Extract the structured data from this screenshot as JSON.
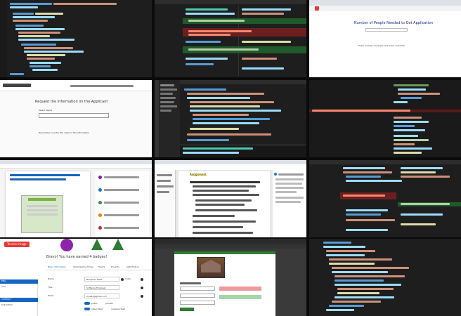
{
  "grid": {
    "tiles": [
      {
        "name": "vscode-code-editor-1"
      },
      {
        "name": "vscode-diff-view"
      },
      {
        "name": "browser-number-of-people-page"
      },
      {
        "name": "browser-form-page"
      },
      {
        "name": "vscode-explorer-editor"
      },
      {
        "name": "terminal-dark-editor"
      },
      {
        "name": "browser-document-editor"
      },
      {
        "name": "word-document-assignment"
      },
      {
        "name": "vscode-diff-red-lines"
      },
      {
        "name": "profile-badges-page"
      },
      {
        "name": "browser-landscape-form"
      },
      {
        "name": "vscode-code-editor-2"
      }
    ]
  },
  "tile3": {
    "title": "Number of People Needed to Get Application",
    "note": "Enter number of people and press calculate"
  },
  "tile4": {
    "title": "Request the Information on the Applicant",
    "field_label": "Select Name",
    "footer": "Remember to enter the data for the information"
  },
  "tile10": {
    "button": "Tennes Image",
    "heading": "Bravo! You have earned 4 badges!",
    "tabs": [
      "Basic Information",
      "Volunteering Times",
      "Teams",
      "Projects",
      "Skill History"
    ],
    "field_labels": [
      "Name",
      "Title",
      "Email"
    ],
    "field_values": [
      "Benjamin Baltz",
      "Software Engineer",
      "b.baltz@gmail.com"
    ],
    "side_values": [
      "Cuba",
      "",
      ""
    ],
    "sidebar": [
      "ENG",
      "mail",
      "",
      "CONTACT",
      "Submitted"
    ],
    "toggles": [
      "public",
      "private",
      "subscribed",
      "unsubscribed"
    ]
  },
  "tile8": {
    "heading": "Assignment",
    "lines": [
      "Detailed Requirements",
      "Program the following",
      "Use constructors",
      "Test the input",
      "Run the program"
    ]
  },
  "colors": {
    "editor_bg": "#1e1e1e",
    "keyword": "#569cd6",
    "string": "#ce9178",
    "func": "#dcdcaa",
    "comment": "#6a9955",
    "diff_red": "#6b1f1f",
    "diff_green": "#1f5a2a",
    "accent_red": "#e53935",
    "accent_blue": "#1565c0"
  }
}
